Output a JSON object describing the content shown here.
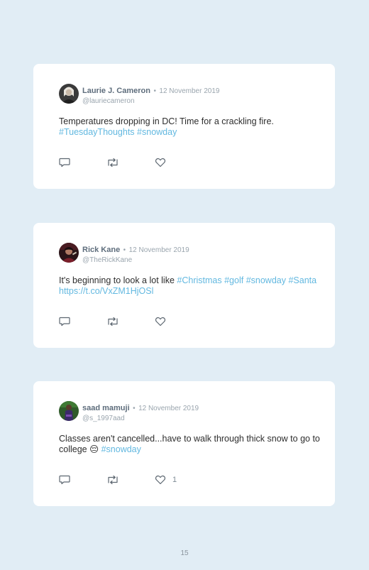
{
  "tweets": [
    {
      "name": "Laurie J. Cameron",
      "separator": "•",
      "date": "12 November 2019",
      "handle": "@lauriecameron",
      "text_parts": [
        {
          "text": "Temperatures dropping in DC! Time for a crackling fire. ",
          "style": "plain"
        },
        {
          "text": "#TuesdayThoughts",
          "style": "tag"
        },
        {
          "text": " ",
          "style": "plain"
        },
        {
          "text": "#snowday",
          "style": "tag"
        }
      ],
      "like_count": ""
    },
    {
      "name": "Rick Kane",
      "separator": "•",
      "date": "12 November 2019",
      "handle": "@TheRickKane",
      "text_parts": [
        {
          "text": "It's beginning to look a lot like ",
          "style": "plain"
        },
        {
          "text": "#Christmas",
          "style": "tag"
        },
        {
          "text": " ",
          "style": "plain"
        },
        {
          "text": "#golf",
          "style": "tag"
        },
        {
          "text": " ",
          "style": "plain"
        },
        {
          "text": "#snowday",
          "style": "tag"
        },
        {
          "text": " ",
          "style": "plain"
        },
        {
          "text": "#Santa",
          "style": "tag"
        },
        {
          "text": " ",
          "style": "plain"
        },
        {
          "text": "https://t.co/VxZM1HjOSl",
          "style": "tag"
        }
      ],
      "like_count": ""
    },
    {
      "name": "saad mamuji",
      "separator": "•",
      "date": "12 November 2019",
      "handle": "@s_1997aad",
      "text_parts": [
        {
          "text": "Classes aren't cancelled...have to walk through thick snow to go to college 😔 ",
          "style": "plain"
        },
        {
          "text": "#snowday",
          "style": "tag"
        }
      ],
      "like_count": "1"
    }
  ],
  "page_number": "15",
  "colors": {
    "background": "#e1edf5",
    "card": "#ffffff",
    "hashtag": "#62b8e0",
    "name": "#5e6d7c",
    "muted": "#9aa5ae"
  },
  "icons": {
    "reply": "reply-icon",
    "retweet": "retweet-icon",
    "like": "heart-icon"
  }
}
